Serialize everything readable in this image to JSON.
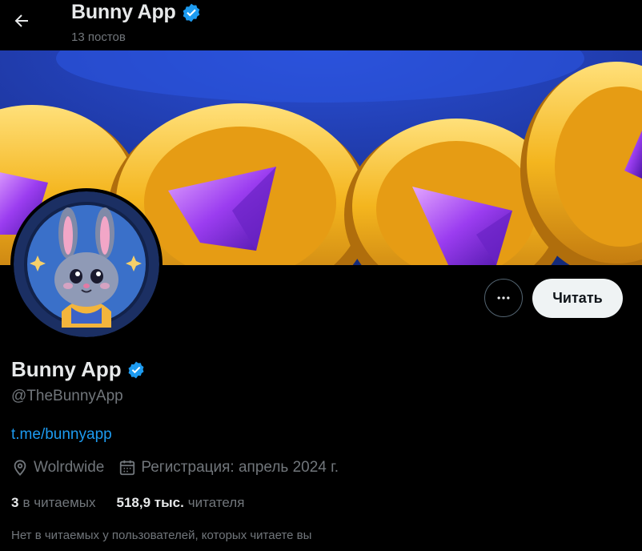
{
  "header": {
    "title": "Bunny App",
    "posts_count": "13 постов"
  },
  "profile": {
    "name": "Bunny App",
    "handle": "@TheBunnyApp",
    "link": "t.me/bunnyapp",
    "location": "Wolrdwide",
    "joined": "Регистрация: апрель 2024 г.",
    "following_count": "3",
    "following_label": "в читаемых",
    "followers_count": "518,9 тыс.",
    "followers_label": "читателя",
    "followers_you_know": "Нет в читаемых у пользователей, которых читаете вы"
  },
  "actions": {
    "follow_label": "Читать",
    "more_icon": "more-dots-icon"
  },
  "colors": {
    "background": "#000000",
    "accent": "#1d9bf0",
    "secondary_text": "#71767b",
    "primary_text": "#e7e9ea",
    "follow_button_bg": "#eff3f4"
  },
  "icons": [
    "back-arrow-icon",
    "verified-badge-icon",
    "location-pin-icon",
    "calendar-icon",
    "more-dots-icon"
  ]
}
